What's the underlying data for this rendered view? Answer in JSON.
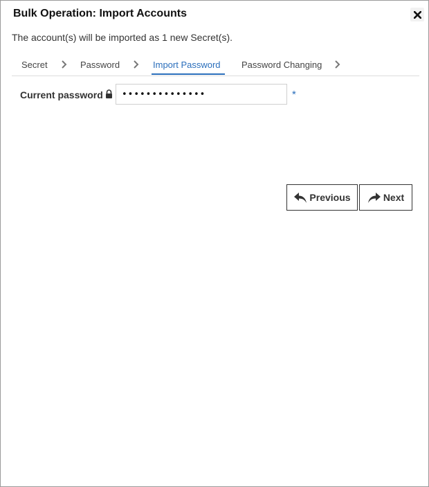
{
  "dialog": {
    "title": "Bulk Operation: Import Accounts",
    "subtitle": "The account(s) will be imported as 1 new Secret(s)."
  },
  "steps": [
    {
      "label": "Secret",
      "active": false
    },
    {
      "label": "Password",
      "active": false
    },
    {
      "label": "Import Password",
      "active": true
    },
    {
      "label": "Password Changing",
      "active": false
    }
  ],
  "form": {
    "current_password_label": "Current password",
    "current_password_value": "••••••••••••••",
    "required_marker": "*"
  },
  "buttons": {
    "previous": "Previous",
    "next": "Next"
  },
  "colors": {
    "accent": "#2a6ebb",
    "text": "#333333",
    "border": "#9a9a9a"
  },
  "icons": [
    "close-icon",
    "chevron-right-icon",
    "lock-icon",
    "undo-arrow-icon",
    "redo-arrow-icon"
  ]
}
